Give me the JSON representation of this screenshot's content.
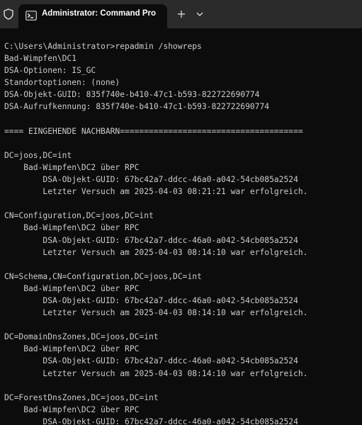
{
  "tab": {
    "title": "Administrator: Command Pro",
    "new_tab_symbol": "+"
  },
  "icons": {
    "shield": "shield-icon",
    "terminal": "command-prompt-icon",
    "new_tab": "plus-icon",
    "dropdown": "chevron-down-icon"
  },
  "colors": {
    "background": "#0c0c0c",
    "titlebar": "#2b2b2b",
    "text": "#cccccc"
  },
  "terminal": {
    "lines": [
      "C:\\Users\\Administrator>repadmin /showreps",
      "Bad-Wimpfen\\DC1",
      "DSA-Optionen: IS_GC",
      "Standortoptionen: (none)",
      "DSA-Objekt-GUID: 835f740e-b410-47c1-b593-822722690774",
      "DSA-Aufrufkennung: 835f740e-b410-47c1-b593-822722690774",
      "",
      "==== EINGEHENDE NACHBARN======================================",
      "",
      "DC=joos,DC=int",
      "    Bad-Wimpfen\\DC2 über RPC",
      "        DSA-Objekt-GUID: 67bc42a7-ddcc-46a0-a042-54cb085a2524",
      "        Letzter Versuch am 2025-04-03 08:21:21 war erfolgreich.",
      "",
      "CN=Configuration,DC=joos,DC=int",
      "    Bad-Wimpfen\\DC2 über RPC",
      "        DSA-Objekt-GUID: 67bc42a7-ddcc-46a0-a042-54cb085a2524",
      "        Letzter Versuch am 2025-04-03 08:14:10 war erfolgreich.",
      "",
      "CN=Schema,CN=Configuration,DC=joos,DC=int",
      "    Bad-Wimpfen\\DC2 über RPC",
      "        DSA-Objekt-GUID: 67bc42a7-ddcc-46a0-a042-54cb085a2524",
      "        Letzter Versuch am 2025-04-03 08:14:10 war erfolgreich.",
      "",
      "DC=DomainDnsZones,DC=joos,DC=int",
      "    Bad-Wimpfen\\DC2 über RPC",
      "        DSA-Objekt-GUID: 67bc42a7-ddcc-46a0-a042-54cb085a2524",
      "        Letzter Versuch am 2025-04-03 08:14:10 war erfolgreich.",
      "",
      "DC=ForestDnsZones,DC=joos,DC=int",
      "    Bad-Wimpfen\\DC2 über RPC",
      "        DSA-Objekt-GUID: 67bc42a7-ddcc-46a0-a042-54cb085a2524"
    ]
  }
}
